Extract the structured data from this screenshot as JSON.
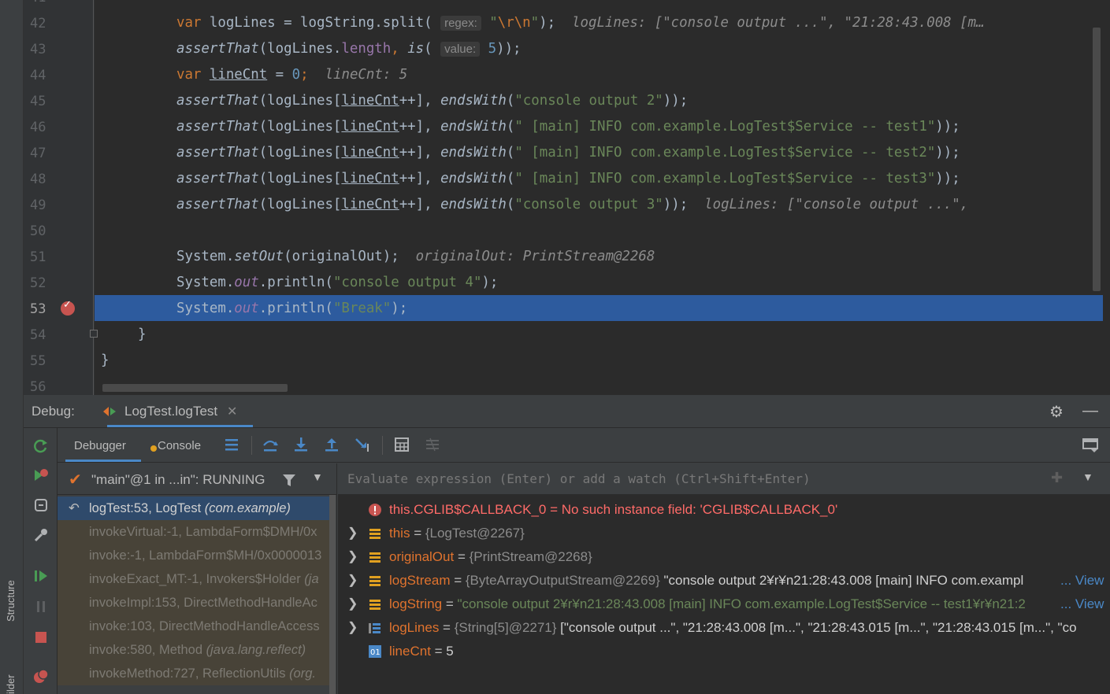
{
  "left_strip": {
    "structure_label": "Structure",
    "builder_label": "ilder"
  },
  "editor": {
    "line_numbers": [
      "42",
      "43",
      "44",
      "45",
      "46",
      "47",
      "48",
      "49",
      "50",
      "51",
      "52",
      "53",
      "54",
      "55",
      "56"
    ],
    "hints": {
      "regex": "regex:",
      "value": "value:"
    },
    "lines": {
      "l42": {
        "a": "var ",
        "b": "logLines = logString.split(",
        "c": "\"",
        "d": "\\r\\n",
        "e": "\"",
        "f": ");",
        "inline": "logLines: [\"console output ...\", \"21:28:43.008 [m…"
      },
      "l43": {
        "a": "assertThat",
        "b": "(logLines.",
        "c": "length",
        "d": ", ",
        "e": "is",
        "f": "(",
        "g": "5",
        "h": "));"
      },
      "l44": {
        "a": "var ",
        "b": "lineCnt",
        "c": " = ",
        "d": "0",
        "e": ";",
        "inline": "lineCnt: 5"
      },
      "l45": {
        "a": "assertThat",
        "b": "(logLines[",
        "c": "lineCnt",
        "d": "++], ",
        "e": "endsWith",
        "f": "(",
        "g": "\"console output 2\"",
        "h": "));"
      },
      "l46": {
        "a": "assertThat",
        "b": "(logLines[",
        "c": "lineCnt",
        "d": "++], ",
        "e": "endsWith",
        "f": "(",
        "g": "\" [main] INFO com.example.LogTest$Service -- test1\"",
        "h": "));"
      },
      "l47": {
        "a": "assertThat",
        "b": "(logLines[",
        "c": "lineCnt",
        "d": "++], ",
        "e": "endsWith",
        "f": "(",
        "g": "\" [main] INFO com.example.LogTest$Service -- test2\"",
        "h": "));"
      },
      "l48": {
        "a": "assertThat",
        "b": "(logLines[",
        "c": "lineCnt",
        "d": "++], ",
        "e": "endsWith",
        "f": "(",
        "g": "\" [main] INFO com.example.LogTest$Service -- test3\"",
        "h": "));"
      },
      "l49": {
        "a": "assertThat",
        "b": "(logLines[",
        "c": "lineCnt",
        "d": "++], ",
        "e": "endsWith",
        "f": "(",
        "g": "\"console output 3\"",
        "h": "));",
        "inline": "logLines: [\"console output ...\","
      },
      "l51": {
        "a": "System.",
        "b": "setOut",
        "c": "(originalOut);",
        "inline": "originalOut: PrintStream@2268"
      },
      "l52": {
        "a": "System.",
        "b": "out",
        "c": ".println(",
        "d": "\"console output 4\"",
        "e": ");"
      },
      "l53": {
        "a": "System.",
        "b": "out",
        "c": ".println(",
        "d": "\"Break\"",
        "e": ");"
      },
      "l54": "}",
      "l55": "}"
    }
  },
  "debug": {
    "label": "Debug:",
    "tab_title": "LogTest.logTest",
    "tab_close": "✕",
    "tabs": {
      "debugger": "Debugger",
      "console": "Console"
    },
    "thread": "\"main\"@1 in ...in\": RUNNING",
    "frames": [
      {
        "text": "logTest:53, LogTest ",
        "pkg": "(com.example)"
      },
      {
        "text": "invokeVirtual:-1, LambdaForm$DMH/0x",
        "pkg": ""
      },
      {
        "text": "invoke:-1, LambdaForm$MH/0x0000013",
        "pkg": ""
      },
      {
        "text": "invokeExact_MT:-1, Invokers$Holder ",
        "pkg": "(ja"
      },
      {
        "text": "invokeImpl:153, DirectMethodHandleAc",
        "pkg": ""
      },
      {
        "text": "invoke:103, DirectMethodHandleAccess",
        "pkg": ""
      },
      {
        "text": "invoke:580, Method ",
        "pkg": "(java.lang.reflect)"
      },
      {
        "text": "invokeMethod:727, ReflectionUtils ",
        "pkg": "(org."
      }
    ],
    "eval_placeholder": "Evaluate expression (Enter) or add a watch (Ctrl+Shift+Enter)",
    "variables": [
      {
        "name": "this.CGLIB$CALLBACK_0",
        "eq": " = ",
        "value": "No such instance field: 'CGLIB$CALLBACK_0'",
        "kind": "error"
      },
      {
        "name": "this",
        "eq": " = ",
        "type": "{LogTest@2267}",
        "kind": "obj"
      },
      {
        "name": "originalOut",
        "eq": " = ",
        "type": "{PrintStream@2268}",
        "kind": "obj"
      },
      {
        "name": "logStream",
        "eq": " = ",
        "type": "{ByteArrayOutputStream@2269}",
        "value": " \"console output 2¥r¥n21:28:43.008 [main] INFO com.exampl",
        "view": "... View",
        "kind": "obj"
      },
      {
        "name": "logString",
        "eq": " = ",
        "value": "\"console output 2¥r¥n21:28:43.008 [main] INFO com.example.LogTest$Service -- test1¥r¥n21:2",
        "view": "... View",
        "kind": "str"
      },
      {
        "name": "logLines",
        "eq": " = ",
        "type": "{String[5]@2271}",
        "value": " [\"console output ...\", \"21:28:43.008 [m...\", \"21:28:43.015 [m...\", \"21:28:43.015 [m...\", \"co",
        "kind": "arr"
      },
      {
        "name": "lineCnt",
        "eq": " = ",
        "value": "5",
        "kind": "int"
      }
    ]
  }
}
